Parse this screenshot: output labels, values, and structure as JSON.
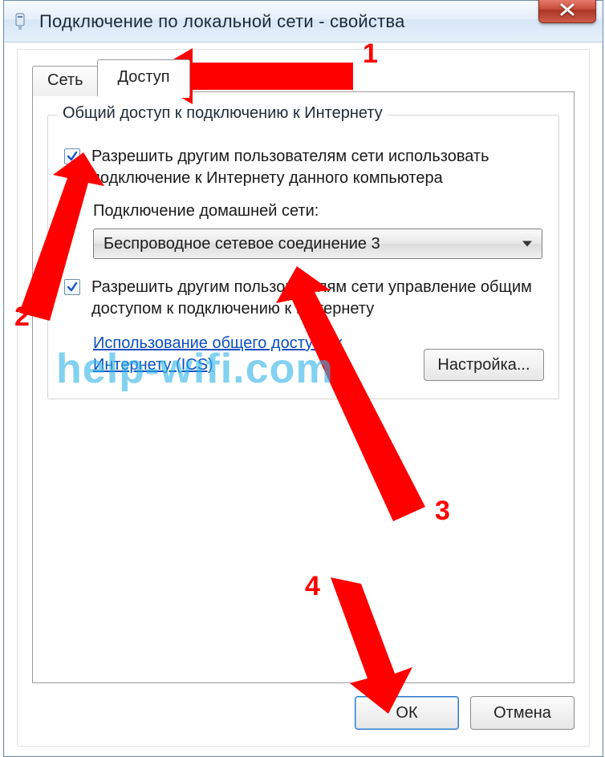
{
  "window": {
    "title": "Подключение по локальной сети - свойства",
    "close_tooltip": "Закрыть"
  },
  "tabs": {
    "network": "Сеть",
    "access": "Доступ"
  },
  "group": {
    "legend": "Общий доступ к подключению к Интернету",
    "allow_share": "Разрешить другим пользователям сети использовать подключение к Интернету данного компьютера",
    "home_conn_label": "Подключение домашней сети:",
    "home_conn_value": "Беспроводное сетевое соединение 3",
    "allow_control": "Разрешить другим пользователям сети управление общим доступом к подключению к Интернету",
    "ics_link": "Использование общего доступа к Интернету (ICS)",
    "settings_btn": "Настройка..."
  },
  "buttons": {
    "ok": "ОК",
    "cancel": "Отмена"
  },
  "annotations": {
    "n1": "1",
    "n2": "2",
    "n3": "3",
    "n4": "4",
    "watermark": "help-wifi.com"
  }
}
